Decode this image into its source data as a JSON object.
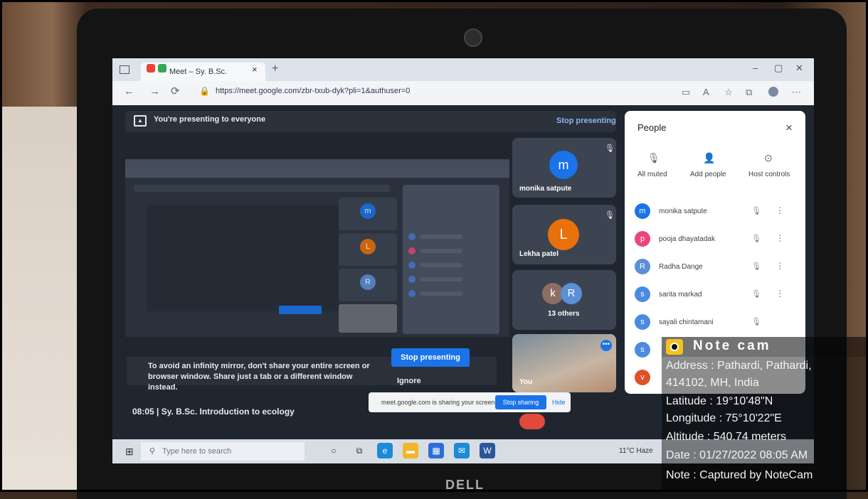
{
  "browser": {
    "tab_title": "Meet – Sy. B.Sc. Introductio",
    "tab_close": "×",
    "new_tab": "+",
    "url": "https://meet.google.com/zbr-txub-dyk?pli=1&authuser=0",
    "win_min": "–",
    "win_max": "▢",
    "win_close": "✕"
  },
  "meet": {
    "banner_text": "You're presenting to everyone",
    "banner_stop": "Stop presenting",
    "tiles": [
      {
        "name": "monika satpute",
        "initial": "m",
        "color": "#1a73e8"
      },
      {
        "name": "Lekha patel",
        "initial": "L",
        "color": "#e8710a"
      },
      {
        "name": "13 others",
        "initials": [
          "k",
          "R"
        ],
        "colors": [
          "#8d6e63",
          "#5b8fd6"
        ]
      }
    ],
    "self_label": "You",
    "dialog_text": "To avoid an infinity mirror, don't share your entire screen or browser window. Share just a tab or a different window instead.",
    "dialog_stop": "Stop presenting",
    "dialog_ignore": "Ignore",
    "bottom_time": "08:05  |  Sy. B.Sc. Introduction to ecology",
    "share_text": "meet.google.com is sharing your screen.",
    "share_stop": "Stop sharing",
    "share_hide": "Hide"
  },
  "people": {
    "title": "People",
    "close": "×",
    "actions": [
      {
        "label": "All muted",
        "icon": "mic-off-icon",
        "glyph": "🎙"
      },
      {
        "label": "Add people",
        "icon": "add-person-icon",
        "glyph": "👤"
      },
      {
        "label": "Host controls",
        "icon": "host-controls-icon",
        "glyph": "⊙"
      }
    ],
    "list": [
      {
        "name": "monika satpute",
        "initial": "m",
        "color": "#1a73e8"
      },
      {
        "name": "pooja dhayatadak",
        "initial": "p",
        "color": "#e8467c"
      },
      {
        "name": "Radha Dange",
        "initial": "R",
        "color": "#5b8fd6"
      },
      {
        "name": "sarita markad",
        "initial": "s",
        "color": "#4a8be0"
      },
      {
        "name": "sayali chintamani",
        "initial": "s",
        "color": "#4a8be0"
      },
      {
        "name": "",
        "initial": "s",
        "color": "#4a8be0"
      },
      {
        "name": "",
        "initial": "v",
        "color": "#e0502a"
      }
    ]
  },
  "taskbar": {
    "search_placeholder": "Type here to search",
    "weather": "11°C Haze"
  },
  "notecam": {
    "title": "Note cam",
    "address_line1": "Address : Pathardi, Pathardi,",
    "address_line2": "414102, MH, India",
    "latitude": "Latitude : 19°10'48\"N",
    "longitude": "Longitude : 75°10'22\"E",
    "altitude": "Altitude : 540.74 meters",
    "date": "Date : 01/27/2022 08:05 AM",
    "note": "Note : Captured by NoteCam"
  },
  "brand": "DELL"
}
